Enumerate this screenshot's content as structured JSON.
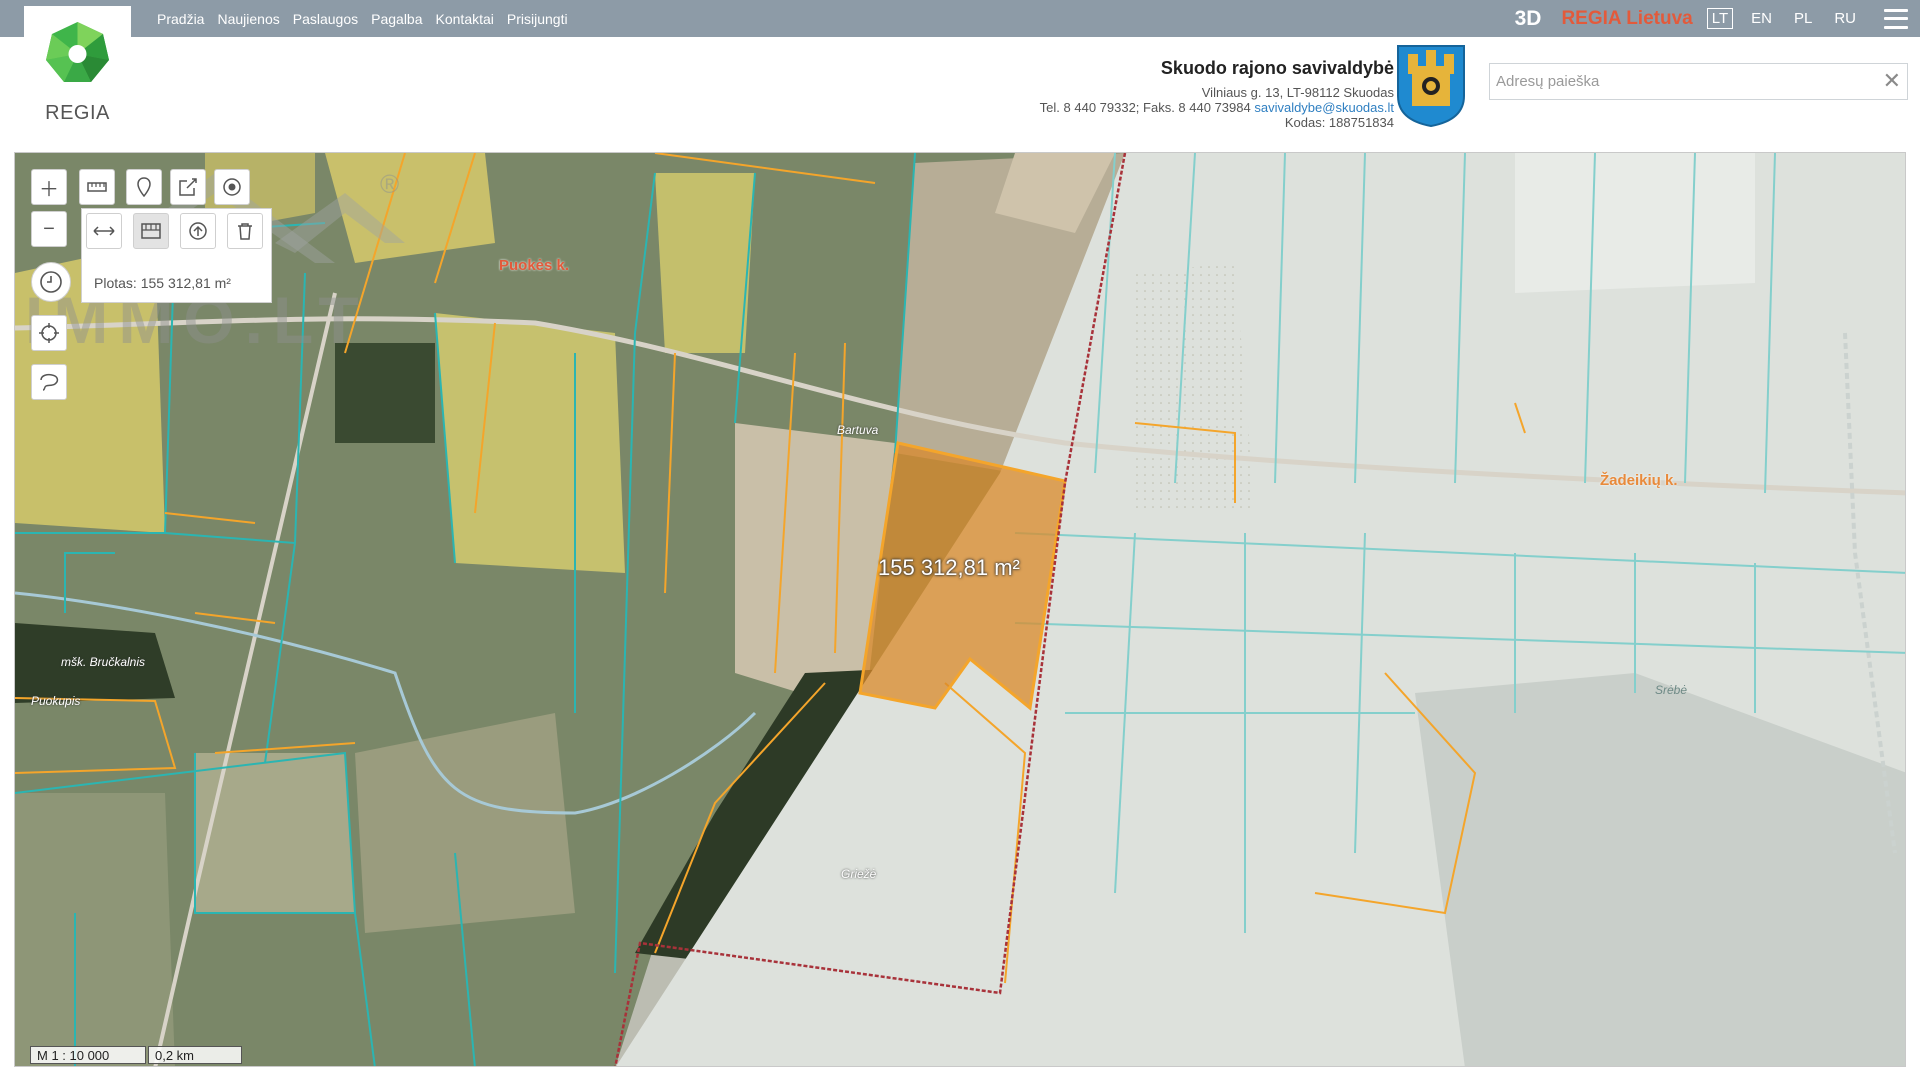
{
  "nav": {
    "items": [
      "Pradžia",
      "Naujienos",
      "Paslaugos",
      "Pagalba",
      "Kontaktai",
      "Prisijungti"
    ]
  },
  "brand": {
    "logo_text": "REGIA"
  },
  "topright": {
    "btn_3d": "3D",
    "regia_lietuva": "REGIA Lietuva",
    "languages": [
      "LT",
      "EN",
      "PL",
      "RU"
    ],
    "active_language": "LT",
    "menu_icon": "hamburger-icon"
  },
  "municipality": {
    "name": "Skuodo rajono savivaldybė",
    "address": "Vilniaus g. 13, LT-98112 Skuodas",
    "phone": "Tel. 8 440 79332; Faks. 8 440 73984",
    "email": "savivaldybe@skuodas.lt",
    "code": "Kodas: 188751834"
  },
  "search": {
    "placeholder": "Adresų paieška",
    "value": "",
    "clear_icon": "close-icon"
  },
  "map_tools": {
    "zoom_in_icon": "plus-icon",
    "zoom_out_icon": "minus-icon",
    "history_icon": "clock-icon",
    "locate_icon": "crosshair-icon",
    "lasso_icon": "lasso-icon",
    "ruler_icon": "ruler-icon",
    "marker_icon": "map-pin-icon",
    "export_icon": "export-icon",
    "target_icon": "target-icon",
    "measure_distance_icon": "distance-icon",
    "measure_area_icon": "area-icon",
    "measure_clear_icon": "trash-icon",
    "area_readout": "Plotas: 155 312,81 m²"
  },
  "map": {
    "selected_area_label": "155 312,81 m²",
    "place_labels": [
      "Puokės k.",
      "Žadeikių k.",
      "mšk. Bručkalnis",
      "Puokupis",
      "Griežė",
      "Bartuva",
      "Srėbė"
    ],
    "colors": {
      "parcel_outline": "#f4a52b",
      "cadastral_outline": "#2bb5b2",
      "district_border": "#a8323a",
      "selected_fill": "#d98a2b"
    }
  },
  "scale": {
    "ratio": "M 1 : 10 000",
    "distance": "0,2 km"
  },
  "watermark": {
    "text": "IMMO.LT",
    "mark": "®"
  }
}
